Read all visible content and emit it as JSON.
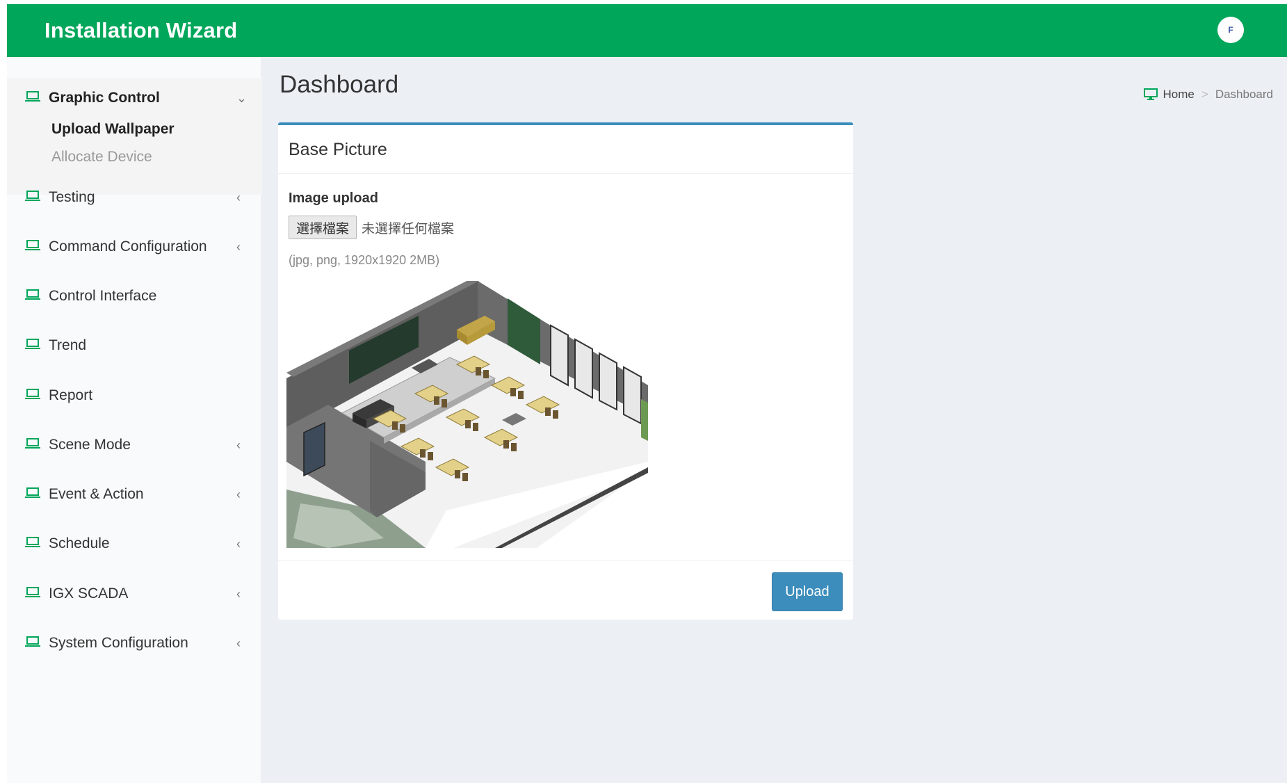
{
  "header": {
    "title": "Installation Wizard",
    "avatar_glyph": "F"
  },
  "sidebar": {
    "items": [
      {
        "label": "Graphic Control",
        "chevron": "⌄",
        "expanded": true
      },
      {
        "label": "Testing",
        "chevron": "‹"
      },
      {
        "label": "Command Configuration",
        "chevron": "‹"
      },
      {
        "label": "Control Interface",
        "chevron": ""
      },
      {
        "label": "Trend",
        "chevron": ""
      },
      {
        "label": "Report",
        "chevron": ""
      },
      {
        "label": "Scene Mode",
        "chevron": "‹"
      },
      {
        "label": "Event & Action",
        "chevron": "‹"
      },
      {
        "label": "Schedule",
        "chevron": "‹"
      },
      {
        "label": "IGX SCADA",
        "chevron": "‹"
      },
      {
        "label": "System Configuration",
        "chevron": "‹"
      }
    ],
    "subitems": [
      {
        "label": "Upload Wallpaper",
        "active": true
      },
      {
        "label": "Allocate Device",
        "active": false
      }
    ],
    "item_icon": "laptop-icon"
  },
  "content": {
    "page_title": "Dashboard",
    "breadcrumb": {
      "home": "Home",
      "separator": ">",
      "current": "Dashboard"
    },
    "box": {
      "title": "Base Picture",
      "field_label": "Image upload",
      "file_button": "選擇檔案",
      "file_status": "未選擇任何檔案",
      "help_text": "(jpg, png, 1920x1920 2MB)",
      "upload_button": "Upload"
    }
  },
  "colors": {
    "header_bg": "#00a65a",
    "accent_blue": "#3c8dbc",
    "content_bg": "#ecf0f5",
    "sidebar_bg": "#f9fafc"
  }
}
